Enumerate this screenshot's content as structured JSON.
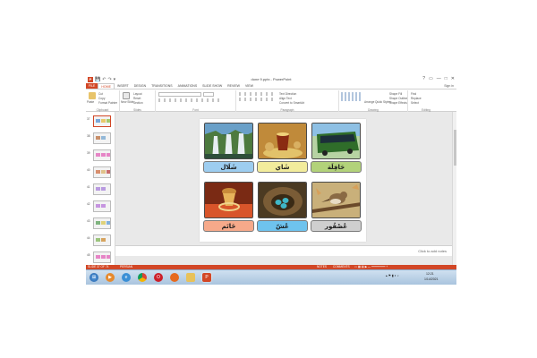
{
  "window": {
    "title": "done 9.pptx - PowerPoint",
    "app_icon": "P",
    "qat": [
      "💾",
      "↶",
      "↷",
      "▾"
    ],
    "controls": [
      "?",
      "▭",
      "—",
      "□",
      "✕"
    ],
    "signin": "Sign in"
  },
  "tabs": [
    "FILE",
    "HOME",
    "INSERT",
    "DESIGN",
    "TRANSITIONS",
    "ANIMATIONS",
    "SLIDE SHOW",
    "REVIEW",
    "VIEW"
  ],
  "ribbon": {
    "clipboard": {
      "paste": "Paste",
      "cut": "Cut",
      "copy": "Copy",
      "format_painter": "Format Painter",
      "label": "Clipboard"
    },
    "slides": {
      "new_slide": "New Slide",
      "layout": "Layout",
      "reset": "Reset",
      "section": "Section",
      "label": "Slides"
    },
    "font": {
      "label": "Font"
    },
    "paragraph": {
      "text_direction": "Text Direction",
      "align_text": "Align Text",
      "convert_smartart": "Convert to SmartArt",
      "label": "Paragraph"
    },
    "drawing": {
      "arrange": "Arrange",
      "quick_styles": "Quick Styles",
      "shape_fill": "Shape Fill",
      "shape_outline": "Shape Outline",
      "shape_effects": "Shape Effects",
      "label": "Drawing"
    },
    "editing": {
      "find": "Find",
      "replace": "Replace",
      "select": "Select",
      "label": "Editing"
    }
  },
  "slide_panel": {
    "thumbnails": [
      "37",
      "38",
      "39",
      "40",
      "41",
      "42",
      "43",
      "44",
      "45"
    ]
  },
  "slide": {
    "cards": [
      {
        "label": "شَلَال",
        "label_color": "#9dcdf0",
        "pic": "waterfall"
      },
      {
        "label": "شَاي",
        "label_color": "#f2ec9c",
        "pic": "tea"
      },
      {
        "label": "حَافِلَة",
        "label_color": "#b2d27a",
        "pic": "bus"
      },
      {
        "label": "خَاتَم",
        "label_color": "#f6a98a",
        "pic": "ring"
      },
      {
        "label": "عُشّ",
        "label_color": "#6ec3ee",
        "pic": "nest"
      },
      {
        "label": "عُصْفُور",
        "label_color": "#cfcfcf",
        "pic": "bird"
      }
    ]
  },
  "notes": {
    "placeholder": "Click to add notes"
  },
  "status": {
    "slide_info": "SLIDE 37 OF 74",
    "language": "PERSIAN",
    "notes": "NOTES",
    "comments": "COMMENTS"
  },
  "taskbar": {
    "apps": [
      "start",
      "media-player",
      "ie",
      "chrome",
      "opera",
      "firefox",
      "explorer",
      "powerpoint"
    ],
    "time": "12:21",
    "date": "1/14/2021"
  },
  "colors": {
    "accent": "#d24726",
    "taskbar": "#b9d0e6"
  }
}
